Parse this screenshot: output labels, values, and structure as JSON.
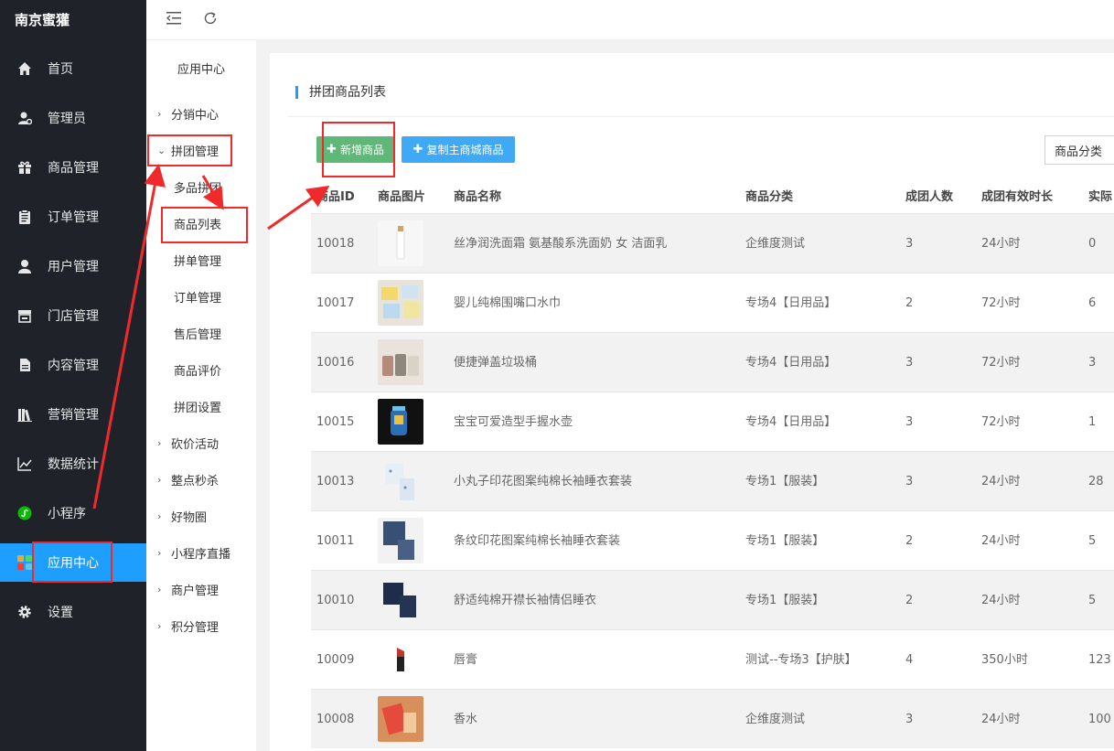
{
  "app": {
    "brand": "南京蜜獾"
  },
  "sidebar": {
    "items": [
      {
        "label": "首页",
        "icon": "home-icon"
      },
      {
        "label": "管理员",
        "icon": "admin-icon"
      },
      {
        "label": "商品管理",
        "icon": "gift-icon"
      },
      {
        "label": "订单管理",
        "icon": "clipboard-icon"
      },
      {
        "label": "用户管理",
        "icon": "user-icon"
      },
      {
        "label": "门店管理",
        "icon": "store-icon"
      },
      {
        "label": "内容管理",
        "icon": "document-icon"
      },
      {
        "label": "营销管理",
        "icon": "books-icon"
      },
      {
        "label": "数据统计",
        "icon": "line-chart-icon"
      },
      {
        "label": "小程序",
        "icon": "mini-program-icon"
      },
      {
        "label": "应用中心",
        "icon": "apps-icon",
        "active": true
      },
      {
        "label": "设置",
        "icon": "gear-icon"
      }
    ]
  },
  "subnav": {
    "title": "应用中心",
    "items": [
      {
        "label": "分销中心"
      },
      {
        "label": "拼团管理",
        "expanded": true
      },
      {
        "label": "砍价活动"
      },
      {
        "label": "整点秒杀"
      },
      {
        "label": "好物圈"
      },
      {
        "label": "小程序直播"
      },
      {
        "label": "商户管理"
      },
      {
        "label": "积分管理"
      }
    ],
    "children": [
      "多品拼团",
      "商品列表",
      "拼单管理",
      "订单管理",
      "售后管理",
      "商品评价",
      "拼团设置"
    ]
  },
  "topbar": {
    "icons": [
      "menu-fold-icon",
      "refresh-icon"
    ]
  },
  "main": {
    "title": "拼团商品列表",
    "add_button": "新增商品",
    "copy_button": "复制主商城商品",
    "category_select": "商品分类",
    "columns": [
      "商品ID",
      "商品图片",
      "商品名称",
      "商品分类",
      "成团人数",
      "成团有效时长",
      "实际"
    ],
    "rows": [
      {
        "id": "10018",
        "name": "丝净润洗面霜 氨基酸系洗面奶 女 洁面乳",
        "category": "企维度测试",
        "people": "3",
        "duration": "24小时",
        "actual": "0",
        "thumb": "white-bottle"
      },
      {
        "id": "10017",
        "name": "婴儿纯棉围嘴口水巾",
        "category": "专场4【日用品】",
        "people": "2",
        "duration": "72小时",
        "actual": "6",
        "thumb": "bibs"
      },
      {
        "id": "10016",
        "name": "便捷弹盖垃圾桶",
        "category": "专场4【日用品】",
        "people": "3",
        "duration": "72小时",
        "actual": "3",
        "thumb": "bins"
      },
      {
        "id": "10015",
        "name": "宝宝可爱造型手握水壶",
        "category": "专场4【日用品】",
        "people": "3",
        "duration": "72小时",
        "actual": "1",
        "thumb": "kettle"
      },
      {
        "id": "10013",
        "name": "小丸子印花图案纯棉长袖睡衣套装",
        "category": "专场1【服装】",
        "people": "3",
        "duration": "24小时",
        "actual": "28",
        "thumb": "pajama-white"
      },
      {
        "id": "10011",
        "name": "条纹印花图案纯棉长袖睡衣套装",
        "category": "专场1【服装】",
        "people": "2",
        "duration": "24小时",
        "actual": "5",
        "thumb": "pajama-navy"
      },
      {
        "id": "10010",
        "name": "舒适纯棉开襟长袖情侣睡衣",
        "category": "专场1【服装】",
        "people": "2",
        "duration": "24小时",
        "actual": "5",
        "thumb": "pajama-dark"
      },
      {
        "id": "10009",
        "name": "唇膏",
        "category": "测试--专场3【护肤】",
        "people": "4",
        "duration": "350小时",
        "actual": "123",
        "thumb": "lipstick"
      },
      {
        "id": "10008",
        "name": "香水",
        "category": "企维度测试",
        "people": "3",
        "duration": "24小时",
        "actual": "100",
        "thumb": "perfume"
      }
    ]
  },
  "colors": {
    "sidebar_bg": "#20222a",
    "active": "#1e9fff",
    "green": "#5fb878",
    "blue": "#3fa9f5",
    "annotation": "#f02a2a"
  }
}
